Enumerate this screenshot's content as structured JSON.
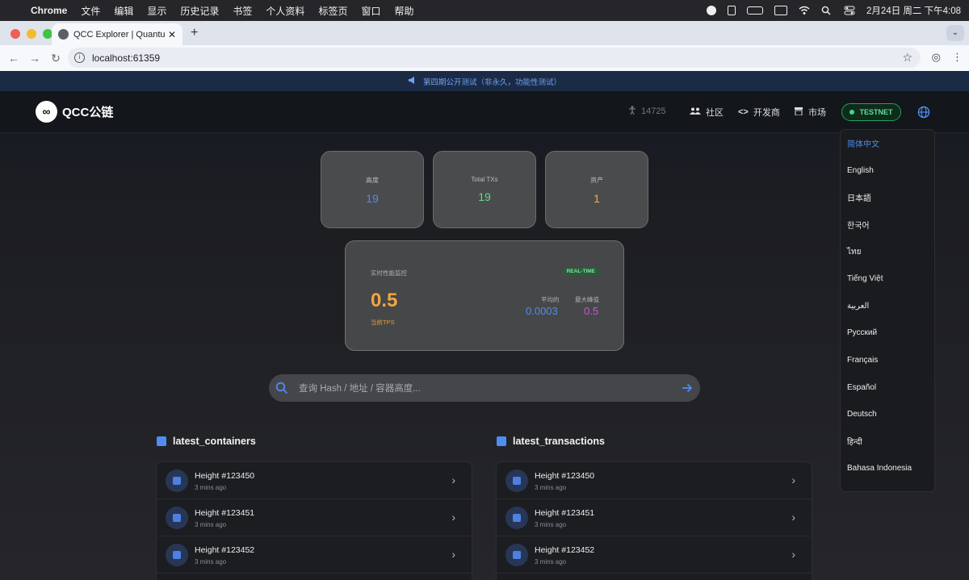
{
  "menubar": {
    "items": [
      "Chrome",
      "文件",
      "编辑",
      "显示",
      "历史记录",
      "书签",
      "个人资料",
      "标签页",
      "窗口",
      "帮助"
    ],
    "datetime": "2月24日 周二 下午4:08"
  },
  "browser": {
    "tab_title": "QCC Explorer | Quantum Con",
    "url": "localhost:61359"
  },
  "announcement": {
    "text": "第四期公开测试（非永久，功能性测试）"
  },
  "header": {
    "logo_text": "QCC公链",
    "count": "14725",
    "nav": [
      "社区",
      "开发商",
      "市场"
    ],
    "network_badge": "TESTNET"
  },
  "stats": [
    {
      "label": "高度",
      "value": "19",
      "color": "#4d8dee"
    },
    {
      "label": "Total TXs",
      "value": "19",
      "color": "#5fdb8f"
    },
    {
      "label": "资产",
      "value": "1",
      "color": "#f2b33e"
    }
  ],
  "tps": {
    "title": "实时性能监控",
    "badge": "REAL-TIME",
    "current": "0.5",
    "current_label": "当前TPS",
    "avg_label": "平均的",
    "avg_value": "0.0003",
    "max_label": "最大峰值",
    "max_value": "0.5"
  },
  "search": {
    "placeholder": "查询 Hash / 地址 / 容器高度..."
  },
  "containers": {
    "title": "latest_containers",
    "rows": [
      {
        "title": "Height #123450",
        "sub": "3 mins ago"
      },
      {
        "title": "Height #123451",
        "sub": "3 mins ago"
      },
      {
        "title": "Height #123452",
        "sub": "3 mins ago"
      }
    ]
  },
  "transactions": {
    "title": "latest_transactions",
    "rows": [
      {
        "title": "Height #123450",
        "sub": "3 mins ago"
      },
      {
        "title": "Height #123451",
        "sub": "3 mins ago"
      },
      {
        "title": "Height #123452",
        "sub": "3 mins ago"
      }
    ]
  },
  "languages": {
    "active": "简体中文",
    "items": [
      "简体中文",
      "English",
      "日本語",
      "한국어",
      "ไทย",
      "Tiếng Việt",
      "العربية",
      "Русский",
      "Français",
      "Español",
      "Deutsch",
      "हिन्दी",
      "Bahasa Indonesia"
    ]
  }
}
